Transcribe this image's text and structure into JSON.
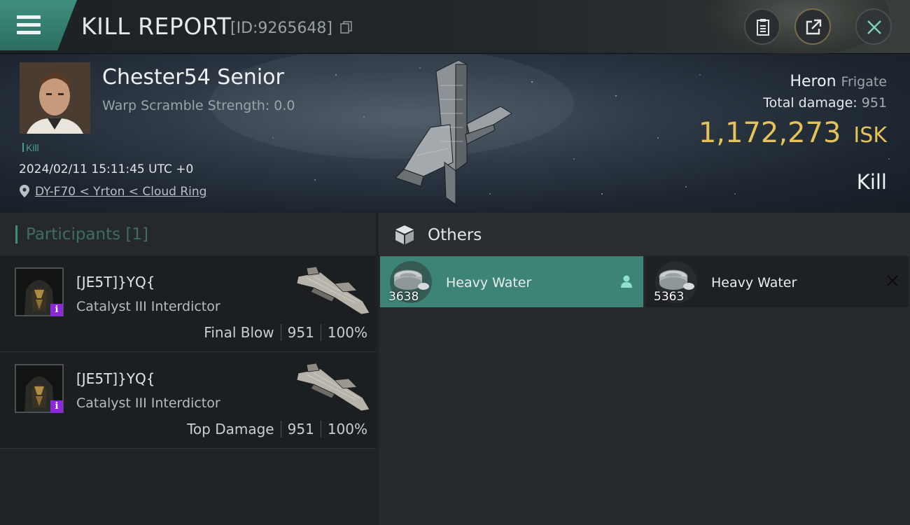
{
  "header": {
    "title": "KILL REPORT",
    "report_id": "[ID:9265648]",
    "icons": [
      "menu-icon",
      "copy-icon",
      "clipboard-icon",
      "share-icon",
      "close-icon"
    ]
  },
  "victim": {
    "name": "Chester54 Senior",
    "warp_scramble": "Warp Scramble Strength: 0.0",
    "tag": "Kill",
    "datetime": "2024/02/11 15:11:45 UTC +0",
    "location": "DY-F70 < Yrton < Cloud Ring",
    "ship_name": "Heron",
    "ship_class": "Frigate",
    "total_damage_label": "Total damage:",
    "total_damage_value": "951",
    "isk_value": "1,172,273",
    "isk_unit": "ISK",
    "result": "Kill"
  },
  "participants": {
    "label": "Participants [1]",
    "rows": [
      {
        "name": "[JE5T]}YQ{",
        "ship": "Catalyst III Interdictor",
        "badge": "i",
        "role": "Final Blow",
        "damage": "951",
        "percent": "100%"
      },
      {
        "name": "[JE5T]}YQ{",
        "ship": "Catalyst III Interdictor",
        "badge": "i",
        "role": "Top Damage",
        "damage": "951",
        "percent": "100%"
      }
    ]
  },
  "others": {
    "label": "Others",
    "items": [
      {
        "name": "Heavy Water",
        "qty": "3638",
        "selected": true,
        "side_icon": "person-icon"
      },
      {
        "name": "Heavy Water",
        "qty": "5363",
        "selected": false,
        "side_icon": "close-icon"
      }
    ]
  },
  "colors": {
    "accent": "#3e8476",
    "isk": "#e6c25a",
    "badge": "#8a2ad6"
  }
}
